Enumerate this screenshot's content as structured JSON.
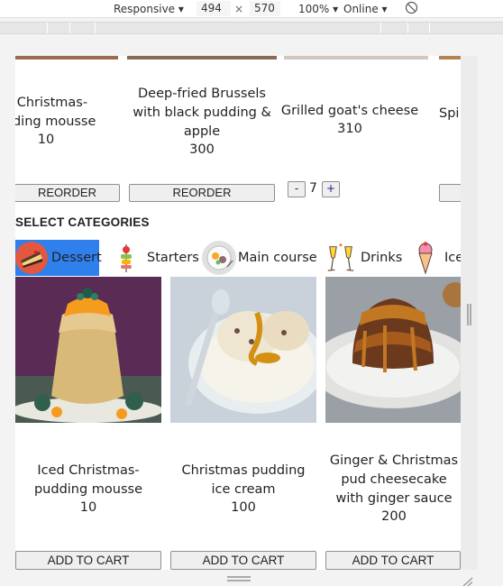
{
  "devtools": {
    "device": "Responsive",
    "width": "494",
    "times": "×",
    "height": "570",
    "zoom": "100%",
    "network": "Online"
  },
  "top_products": [
    {
      "name": "d Christmas-\nudding mousse",
      "price": "10",
      "button": "REORDER"
    },
    {
      "name": "Deep-fried Brussels with black pudding & apple",
      "price": "300",
      "button": "REORDER"
    },
    {
      "name": "Grilled goat's cheese",
      "price": "310",
      "qty_minus": "-",
      "qty": "7",
      "qty_plus": "+"
    },
    {
      "name": "Spi",
      "price": ""
    }
  ],
  "categories_title": "SELECT CATEGORIES",
  "categories": [
    {
      "label": "Dessert",
      "icon": "cake-icon",
      "active": true
    },
    {
      "label": "Starters",
      "icon": "skewer-icon",
      "active": false
    },
    {
      "label": "Main course",
      "icon": "plate-icon",
      "active": false
    },
    {
      "label": "Drinks",
      "icon": "champagne-icon",
      "active": false
    },
    {
      "label": "Ice",
      "icon": "ice-cream-icon",
      "active": false
    }
  ],
  "products": [
    {
      "name": "Iced Christmas-pudding mousse",
      "price": "10",
      "button": "ADD TO CART"
    },
    {
      "name": "Christmas pudding ice cream",
      "price": "100",
      "button": "ADD TO CART"
    },
    {
      "name": "Ginger & Christmas pud cheesecake with ginger sauce",
      "price": "200",
      "button": "ADD TO CART"
    }
  ],
  "colors": {
    "active_category": "#2f80ed",
    "button_bg": "#efefef"
  }
}
